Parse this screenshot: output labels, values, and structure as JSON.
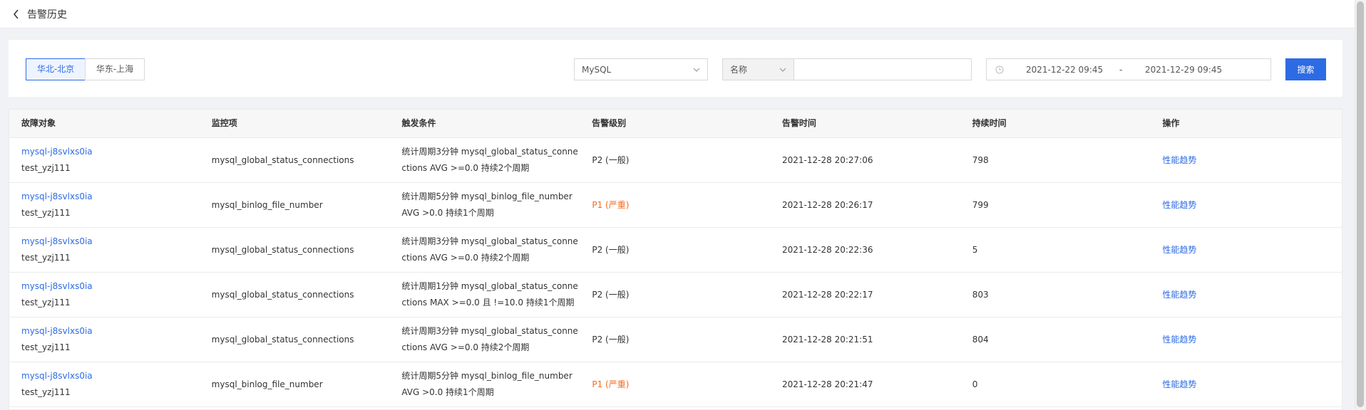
{
  "header": {
    "title": "告警历史"
  },
  "filters": {
    "regions": [
      "华北-北京",
      "华东-上海"
    ],
    "db_type": "MySQL",
    "field_select": "名称",
    "name_value": "",
    "date_start": "2021-12-22 09:45",
    "date_sep": "-",
    "date_end": "2021-12-29 09:45",
    "search_label": "搜索"
  },
  "table": {
    "columns": [
      "故障对象",
      "监控项",
      "触发条件",
      "告警级别",
      "告警时间",
      "持续时间",
      "操作"
    ],
    "rows": [
      {
        "object_id": "mysql-j8svlxs0ia",
        "object_name": "test_yzj111",
        "metric": "mysql_global_status_connections",
        "condition": "统计周期3分钟 mysql_global_status_connections AVG >=0.0 持续2个周期",
        "level": "P2 (一般)",
        "time": "2021-12-28 20:27:06",
        "duration": "798",
        "action": "性能趋势"
      },
      {
        "object_id": "mysql-j8svlxs0ia",
        "object_name": "test_yzj111",
        "metric": "mysql_binlog_file_number",
        "condition": "统计周期5分钟 mysql_binlog_file_number AVG >0.0 持续1个周期",
        "level": "P1 (严重)",
        "time": "2021-12-28 20:26:17",
        "duration": "799",
        "action": "性能趋势"
      },
      {
        "object_id": "mysql-j8svlxs0ia",
        "object_name": "test_yzj111",
        "metric": "mysql_global_status_connections",
        "condition": "统计周期3分钟 mysql_global_status_connections AVG >=0.0 持续2个周期",
        "level": "P2 (一般)",
        "time": "2021-12-28 20:22:36",
        "duration": "5",
        "action": "性能趋势"
      },
      {
        "object_id": "mysql-j8svlxs0ia",
        "object_name": "test_yzj111",
        "metric": "mysql_global_status_connections",
        "condition": "统计周期1分钟 mysql_global_status_connections MAX >=0.0 且 !=10.0 持续1个周期",
        "level": "P2 (一般)",
        "time": "2021-12-28 20:22:17",
        "duration": "803",
        "action": "性能趋势"
      },
      {
        "object_id": "mysql-j8svlxs0ia",
        "object_name": "test_yzj111",
        "metric": "mysql_global_status_connections",
        "condition": "统计周期3分钟 mysql_global_status_connections AVG >=0.0 持续2个周期",
        "level": "P2 (一般)",
        "time": "2021-12-28 20:21:51",
        "duration": "804",
        "action": "性能趋势"
      },
      {
        "object_id": "mysql-j8svlxs0ia",
        "object_name": "test_yzj111",
        "metric": "mysql_binlog_file_number",
        "condition": "统计周期5分钟 mysql_binlog_file_number AVG >0.0 持续1个周期",
        "level": "P1 (严重)",
        "time": "2021-12-28 20:21:47",
        "duration": "0",
        "action": "性能趋势"
      }
    ]
  },
  "colors": {
    "accent": "#2d6be4",
    "severity_p1": "#f56b1f"
  },
  "icons": {
    "back": "chevron-left-icon",
    "clock": "clock-icon",
    "dropdown": "chevron-down-icon"
  }
}
